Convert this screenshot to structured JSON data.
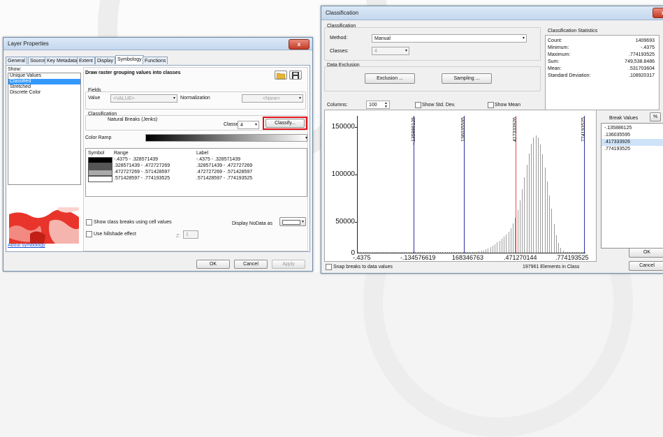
{
  "layer_window": {
    "title": "Layer Properties",
    "close": "x",
    "tabs": [
      "General",
      "Source",
      "Key Metadata",
      "Extent",
      "Display",
      "Symbology",
      "Functions"
    ],
    "show_label": "Show:",
    "show_items": [
      "Unique Values",
      "Classified",
      "Stretched",
      "Discrete Color"
    ],
    "selected_show": 1,
    "heading": "Draw raster grouping values into classes",
    "fields_label": "Fields",
    "value_label": "Value",
    "value_field": "<VALUE>",
    "normalization_label": "Normalization",
    "normalization_field": "<None>",
    "classification_label": "Classification",
    "method_text": "Natural Breaks (Jenks)",
    "classes_label": "Classes",
    "classes_value": "4",
    "classify_button": "Classify...",
    "color_ramp_label": "Color Ramp",
    "table_headers": [
      "Symbol",
      "Range",
      "Label"
    ],
    "rows": [
      {
        "range": "-.4375 - .328571439",
        "label": "-.4375 - .328571439",
        "color": "#000000"
      },
      {
        "range": ".328571439 - .472727269",
        "label": ".328571439 - .472727269",
        "color": "#555555"
      },
      {
        "range": ".472727269 - .571428597",
        "label": ".472727269 - .571428597",
        "color": "#aaaaaa"
      },
      {
        "range": ".571428597 - .774193525",
        "label": ".571428597 - .774193525",
        "color": "#ffffff"
      }
    ],
    "show_breaks_label": "Show class breaks using cell values",
    "hillshade_label": "Use hillshade effect",
    "z_label": "Z:",
    "z_value": "1",
    "nodata_label": "Display NoData as",
    "about_link": "About symbology",
    "ok": "OK",
    "cancel": "Cancel",
    "apply": "Apply"
  },
  "class_window": {
    "title": "Classification",
    "close": "x",
    "classification_label": "Classification",
    "method_label": "Method:",
    "method_value": "Manual",
    "classes_label": "Classes:",
    "classes_value": "4",
    "exclusion_group": "Data Exclusion",
    "exclusion_button": "Exclusion ...",
    "sampling_button": "Sampling ...",
    "stats_title": "Classification Statistics",
    "stats": [
      {
        "k": "Count:",
        "v": "1409693"
      },
      {
        "k": "Minimum:",
        "v": "-.4375"
      },
      {
        "k": "Maximum:",
        "v": ".774193525"
      },
      {
        "k": "Sum:",
        "v": "749,538.8486"
      },
      {
        "k": "Mean:",
        "v": ".531703604"
      },
      {
        "k": "Standard Deviation:",
        "v": ".108920317"
      }
    ],
    "columns_label": "Columns:",
    "columns_value": "100",
    "show_std_label": "Show Std. Dev.",
    "show_mean_label": "Show Mean",
    "y_ticks": [
      "150000",
      "100000",
      "50000",
      "0"
    ],
    "x_ticks": [
      "-.4375",
      "-.134576619",
      "168346763",
      ".471270144",
      ".774193525"
    ],
    "break_labels": [
      "-.135886125",
      "136035595",
      "417333926",
      ".774193525"
    ],
    "break_values_label": "Break Values",
    "break_values_pct": "%",
    "break_values": [
      "-.135886125",
      ".136035595",
      ".417333926",
      ".774193525"
    ],
    "selected_break": 2,
    "snap_label": "Snap breaks to data values",
    "elements_text": "197961 Elements in Class",
    "ok": "OK",
    "cancel": "Cancel"
  }
}
